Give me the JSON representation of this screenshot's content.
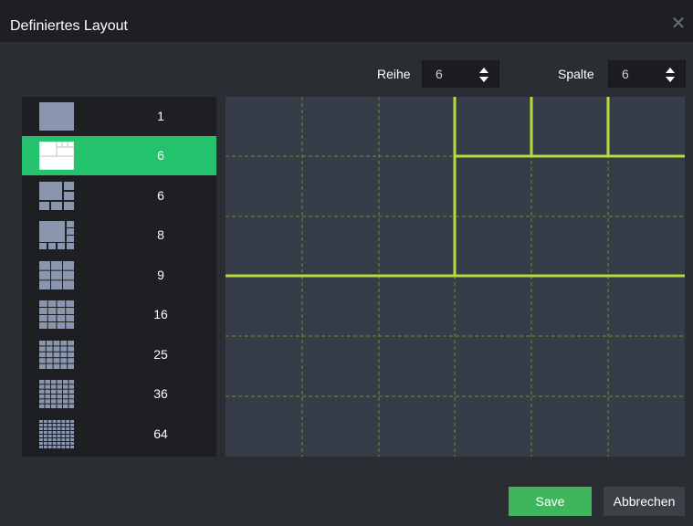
{
  "dialog": {
    "title": "Definiertes Layout",
    "close_icon": "close-icon"
  },
  "controls": {
    "rows_label": "Reihe",
    "rows_value": "6",
    "cols_label": "Spalte",
    "cols_value": "6"
  },
  "layouts": [
    {
      "count": "1",
      "icon": "layout-1-icon",
      "selected": false
    },
    {
      "count": "6",
      "icon": "layout-6-custom-icon",
      "selected": true
    },
    {
      "count": "6",
      "icon": "layout-6-icon",
      "selected": false
    },
    {
      "count": "8",
      "icon": "layout-8-icon",
      "selected": false
    },
    {
      "count": "9",
      "icon": "layout-9-icon",
      "selected": false
    },
    {
      "count": "16",
      "icon": "layout-16-icon",
      "selected": false
    },
    {
      "count": "25",
      "icon": "layout-25-icon",
      "selected": false
    },
    {
      "count": "36",
      "icon": "layout-36-icon",
      "selected": false
    },
    {
      "count": "64",
      "icon": "layout-64-icon",
      "selected": false
    }
  ],
  "buttons": {
    "save": "Save",
    "cancel": "Abbrechen"
  },
  "colors": {
    "accent_green": "#25c26e",
    "save_green": "#3fb65b",
    "grid_line": "#a8d84a",
    "preview_bg": "#363d49"
  }
}
